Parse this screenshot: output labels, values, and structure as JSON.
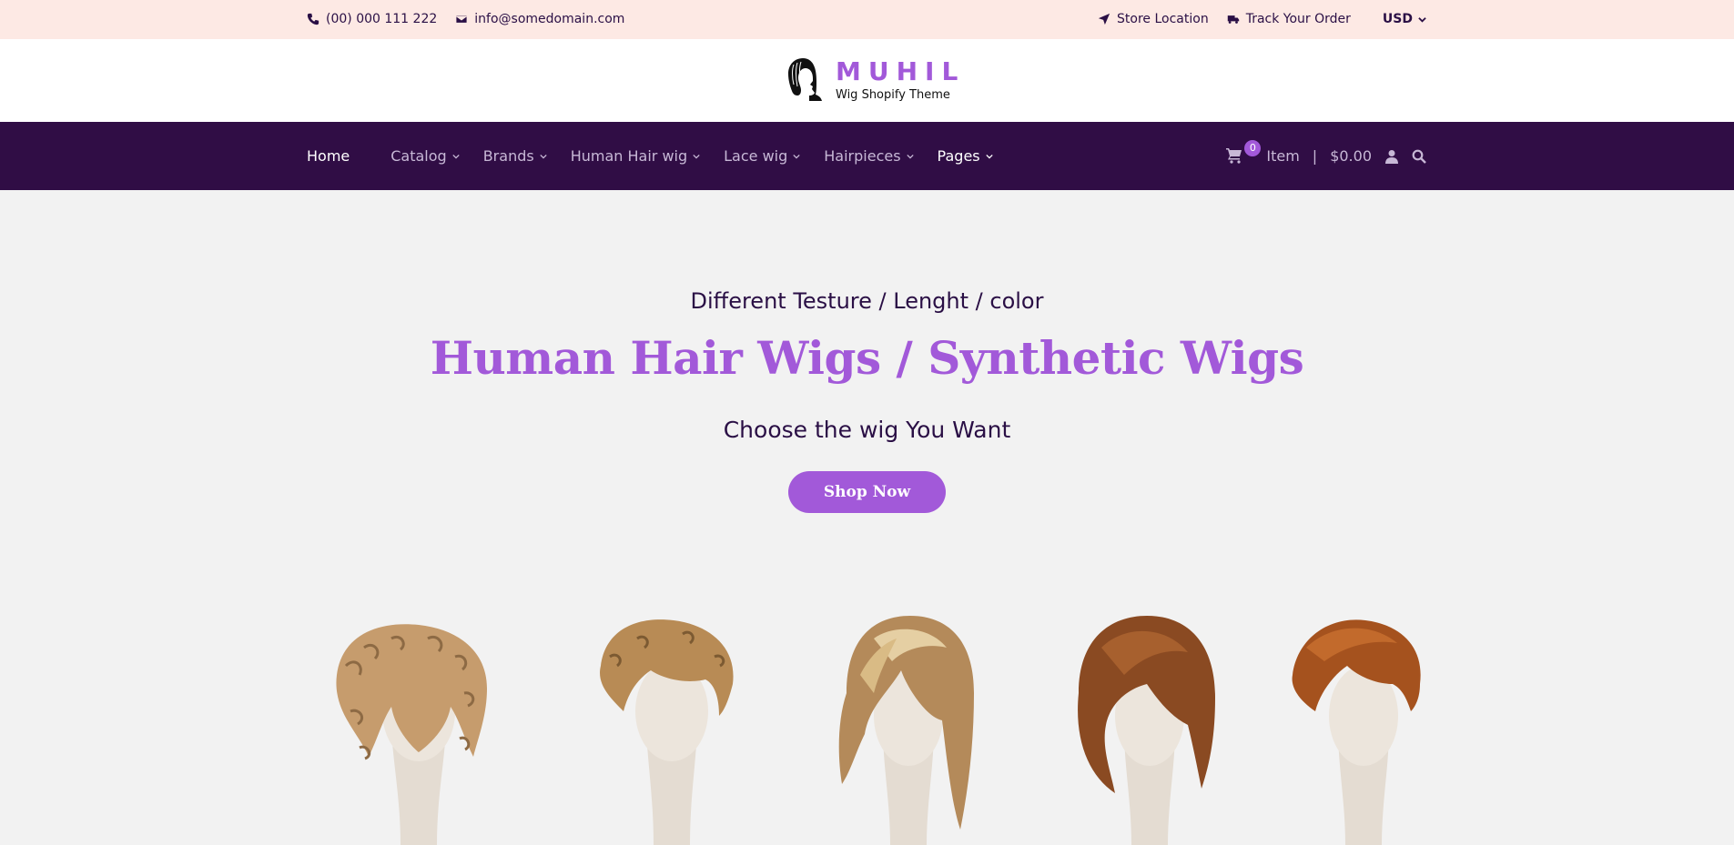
{
  "topbar": {
    "phone": "(00) 000 111 222",
    "email": "info@somedomain.com",
    "store_location": "Store Location",
    "track_order": "Track Your Order",
    "currency": "USD"
  },
  "brand": {
    "name": "MUHIL",
    "tagline": "Wig Shopify Theme"
  },
  "nav": {
    "items": [
      {
        "label": "Home"
      },
      {
        "label": "Catalog"
      },
      {
        "label": "Brands"
      },
      {
        "label": "Human Hair wig"
      },
      {
        "label": "Lace wig"
      },
      {
        "label": "Hairpieces"
      },
      {
        "label": "Pages"
      }
    ],
    "cart_count": "0",
    "cart_item_label": "Item",
    "separator": "|",
    "cart_total": "$0.00"
  },
  "hero": {
    "subtitle": "Different Testure / Lenght / color",
    "headline": "Human Hair Wigs / Synthetic Wigs",
    "tagline": "Choose the wig You Want",
    "cta": "Shop Now"
  },
  "colors": {
    "accent": "#a259d9",
    "nav_bg": "#300d45",
    "topbar_bg": "#fde9e4",
    "text_dark": "#2a0f45"
  }
}
